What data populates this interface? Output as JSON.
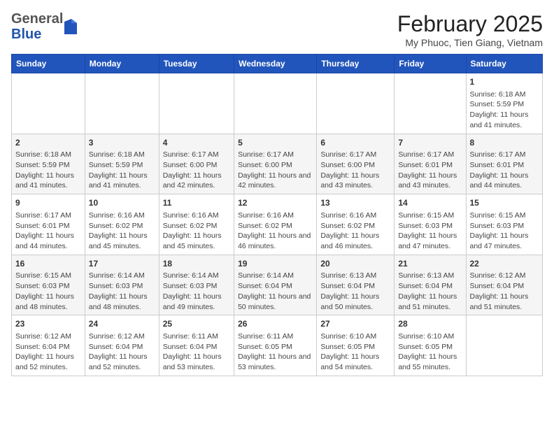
{
  "header": {
    "logo_general": "General",
    "logo_blue": "Blue",
    "main_title": "February 2025",
    "subtitle": "My Phuoc, Tien Giang, Vietnam"
  },
  "days_of_week": [
    "Sunday",
    "Monday",
    "Tuesday",
    "Wednesday",
    "Thursday",
    "Friday",
    "Saturday"
  ],
  "weeks": [
    [
      {
        "day": "",
        "info": ""
      },
      {
        "day": "",
        "info": ""
      },
      {
        "day": "",
        "info": ""
      },
      {
        "day": "",
        "info": ""
      },
      {
        "day": "",
        "info": ""
      },
      {
        "day": "",
        "info": ""
      },
      {
        "day": "1",
        "info": "Sunrise: 6:18 AM\nSunset: 5:59 PM\nDaylight: 11 hours and 41 minutes."
      }
    ],
    [
      {
        "day": "2",
        "info": "Sunrise: 6:18 AM\nSunset: 5:59 PM\nDaylight: 11 hours and 41 minutes."
      },
      {
        "day": "3",
        "info": "Sunrise: 6:18 AM\nSunset: 5:59 PM\nDaylight: 11 hours and 41 minutes."
      },
      {
        "day": "4",
        "info": "Sunrise: 6:17 AM\nSunset: 6:00 PM\nDaylight: 11 hours and 42 minutes."
      },
      {
        "day": "5",
        "info": "Sunrise: 6:17 AM\nSunset: 6:00 PM\nDaylight: 11 hours and 42 minutes."
      },
      {
        "day": "6",
        "info": "Sunrise: 6:17 AM\nSunset: 6:00 PM\nDaylight: 11 hours and 43 minutes."
      },
      {
        "day": "7",
        "info": "Sunrise: 6:17 AM\nSunset: 6:01 PM\nDaylight: 11 hours and 43 minutes."
      },
      {
        "day": "8",
        "info": "Sunrise: 6:17 AM\nSunset: 6:01 PM\nDaylight: 11 hours and 44 minutes."
      }
    ],
    [
      {
        "day": "9",
        "info": "Sunrise: 6:17 AM\nSunset: 6:01 PM\nDaylight: 11 hours and 44 minutes."
      },
      {
        "day": "10",
        "info": "Sunrise: 6:16 AM\nSunset: 6:02 PM\nDaylight: 11 hours and 45 minutes."
      },
      {
        "day": "11",
        "info": "Sunrise: 6:16 AM\nSunset: 6:02 PM\nDaylight: 11 hours and 45 minutes."
      },
      {
        "day": "12",
        "info": "Sunrise: 6:16 AM\nSunset: 6:02 PM\nDaylight: 11 hours and 46 minutes."
      },
      {
        "day": "13",
        "info": "Sunrise: 6:16 AM\nSunset: 6:02 PM\nDaylight: 11 hours and 46 minutes."
      },
      {
        "day": "14",
        "info": "Sunrise: 6:15 AM\nSunset: 6:03 PM\nDaylight: 11 hours and 47 minutes."
      },
      {
        "day": "15",
        "info": "Sunrise: 6:15 AM\nSunset: 6:03 PM\nDaylight: 11 hours and 47 minutes."
      }
    ],
    [
      {
        "day": "16",
        "info": "Sunrise: 6:15 AM\nSunset: 6:03 PM\nDaylight: 11 hours and 48 minutes."
      },
      {
        "day": "17",
        "info": "Sunrise: 6:14 AM\nSunset: 6:03 PM\nDaylight: 11 hours and 48 minutes."
      },
      {
        "day": "18",
        "info": "Sunrise: 6:14 AM\nSunset: 6:03 PM\nDaylight: 11 hours and 49 minutes."
      },
      {
        "day": "19",
        "info": "Sunrise: 6:14 AM\nSunset: 6:04 PM\nDaylight: 11 hours and 50 minutes."
      },
      {
        "day": "20",
        "info": "Sunrise: 6:13 AM\nSunset: 6:04 PM\nDaylight: 11 hours and 50 minutes."
      },
      {
        "day": "21",
        "info": "Sunrise: 6:13 AM\nSunset: 6:04 PM\nDaylight: 11 hours and 51 minutes."
      },
      {
        "day": "22",
        "info": "Sunrise: 6:12 AM\nSunset: 6:04 PM\nDaylight: 11 hours and 51 minutes."
      }
    ],
    [
      {
        "day": "23",
        "info": "Sunrise: 6:12 AM\nSunset: 6:04 PM\nDaylight: 11 hours and 52 minutes."
      },
      {
        "day": "24",
        "info": "Sunrise: 6:12 AM\nSunset: 6:04 PM\nDaylight: 11 hours and 52 minutes."
      },
      {
        "day": "25",
        "info": "Sunrise: 6:11 AM\nSunset: 6:04 PM\nDaylight: 11 hours and 53 minutes."
      },
      {
        "day": "26",
        "info": "Sunrise: 6:11 AM\nSunset: 6:05 PM\nDaylight: 11 hours and 53 minutes."
      },
      {
        "day": "27",
        "info": "Sunrise: 6:10 AM\nSunset: 6:05 PM\nDaylight: 11 hours and 54 minutes."
      },
      {
        "day": "28",
        "info": "Sunrise: 6:10 AM\nSunset: 6:05 PM\nDaylight: 11 hours and 55 minutes."
      },
      {
        "day": "",
        "info": ""
      }
    ]
  ]
}
